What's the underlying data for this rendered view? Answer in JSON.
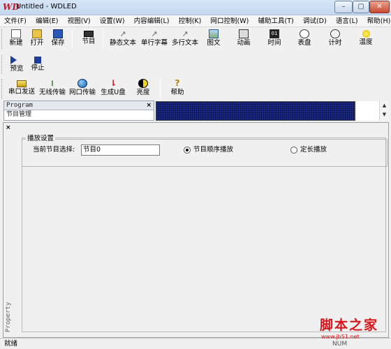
{
  "window": {
    "title": "Untitled - WDLED",
    "app_icon": "WD"
  },
  "menu": [
    "文件(F)",
    "编辑(E)",
    "视图(V)",
    "设置(W)",
    "内容编辑(L)",
    "控制(K)",
    "网口控制(W)",
    "辅助工具(T)",
    "调试(D)",
    "语言(L)",
    "帮助(H)"
  ],
  "toolbar1": [
    {
      "label": "新建",
      "icon": "new-file-icon"
    },
    {
      "label": "打开",
      "icon": "open-folder-icon"
    },
    {
      "label": "保存",
      "icon": "save-disk-icon"
    },
    {
      "label": "节目",
      "icon": "program-icon"
    },
    {
      "label": "静态文本",
      "icon": "static-text-icon"
    },
    {
      "label": "单行字幕",
      "icon": "single-line-caption-icon"
    },
    {
      "label": "多行文本",
      "icon": "multi-line-text-icon"
    },
    {
      "label": "图文",
      "icon": "image-text-icon"
    },
    {
      "label": "动画",
      "icon": "animation-icon"
    },
    {
      "label": "时间",
      "icon": "time-icon"
    },
    {
      "label": "表盘",
      "icon": "clock-dial-icon"
    },
    {
      "label": "计时",
      "icon": "timer-icon"
    },
    {
      "label": "温度",
      "icon": "temperature-icon"
    }
  ],
  "toolbar2": [
    {
      "label": "预览",
      "icon": "play-icon"
    },
    {
      "label": "停止",
      "icon": "stop-icon"
    }
  ],
  "toolbar3": [
    {
      "label": "串口发送",
      "icon": "serial-send-icon"
    },
    {
      "label": "无线传输",
      "icon": "wireless-icon"
    },
    {
      "label": "网口传输",
      "icon": "network-globe-icon"
    },
    {
      "label": "生成U盘",
      "icon": "usb-icon"
    },
    {
      "label": "亮度",
      "icon": "brightness-icon"
    },
    {
      "label": "帮助",
      "icon": "help-icon"
    }
  ],
  "program_panel": {
    "title": "Program",
    "close": "×",
    "tree_text": "节目管理"
  },
  "property_panel": {
    "close": "×",
    "vertical_title": "Property",
    "group_title": "播放设置",
    "current_label": "当前节目选择:",
    "current_value": "节目0",
    "radio1": "节目顺序播放",
    "radio2": "定长播放",
    "radio1_checked": true
  },
  "status": {
    "text": "就绪",
    "right": "NUM"
  },
  "watermark": {
    "text": "脚本之家",
    "url": "www.jb51.net"
  },
  "colors": {
    "led_blue": "#1b2a8f",
    "watermark_red": "#d8151a"
  }
}
